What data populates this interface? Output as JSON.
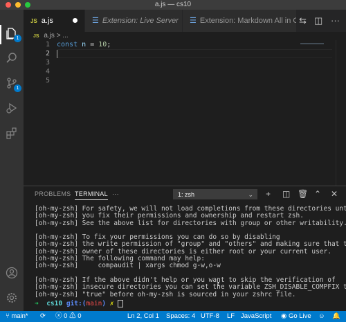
{
  "window": {
    "title": "a.js — cs10",
    "colors": {
      "close": "#ff5f57",
      "minimize": "#febc2e",
      "zoom": "#28c840"
    }
  },
  "activity_bar": {
    "explorer_badge": "1",
    "scm_badge": "1"
  },
  "tabs": [
    {
      "icon": "JS",
      "label": "a.js",
      "dirty": true
    },
    {
      "label": "Extension: Live Server"
    },
    {
      "label": "Extension: Markdown All in One"
    }
  ],
  "breadcrumb": {
    "icon": "JS",
    "file": "a.js",
    "rest": "> ..."
  },
  "editor": {
    "line_numbers": [
      "1",
      "2",
      "3",
      "4",
      "5"
    ],
    "code": {
      "keyword": "const",
      "name": "n",
      "op": "=",
      "value": "10",
      "end": ";"
    }
  },
  "panel": {
    "tabs": [
      "PROBLEMS",
      "TERMINAL"
    ],
    "more": "···",
    "terminal_select": "1: zsh"
  },
  "terminal": {
    "lines": [
      "[oh-my-zsh] For safety, we will not load completions from these directories until",
      "[oh-my-zsh] you fix their permissions and ownership and restart zsh.",
      "[oh-my-zsh] See the above list for directories with group or other writability.",
      "",
      "[oh-my-zsh] To fix your permissions you can do so by disabling",
      "[oh-my-zsh] the write permission of \"group\" and \"others\" and making sure that the",
      "[oh-my-zsh] owner of these directories is either root or your current user.",
      "[oh-my-zsh] The following command may help:",
      "[oh-my-zsh]     compaudit | xargs chmod g-w,o-w",
      "",
      "[oh-my-zsh] If the above didn't help or you want to skip the verification of",
      "[oh-my-zsh] insecure directories you can set the variable ZSH_DISABLE_COMPFIX to",
      "[oh-my-zsh] \"true\" before oh-my-zsh is sourced in your zshrc file."
    ],
    "prompt": {
      "arrow": "➜",
      "dir": "cs10",
      "git": "git:(",
      "branch": "main",
      "git_close": ")",
      "x": "✗"
    }
  },
  "status_bar": {
    "branch": "main*",
    "errors": "0",
    "warnings": "0",
    "position": "Ln 2, Col 1",
    "spaces": "Spaces: 4",
    "encoding": "UTF-8",
    "eol": "LF",
    "language": "JavaScript",
    "go_live": "Go Live",
    "accent": "#007acc"
  }
}
